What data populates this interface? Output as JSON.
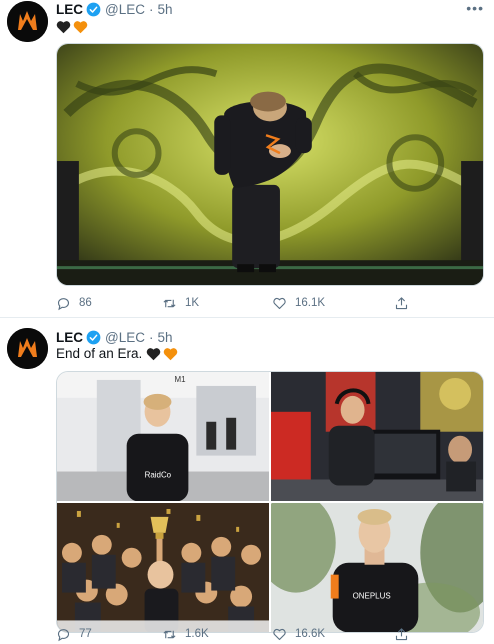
{
  "tweets": [
    {
      "author_name": "LEC",
      "handle": "@LEC",
      "separator": "·",
      "time": "5h",
      "text": "",
      "emoji": [
        "black-heart",
        "orange-heart"
      ],
      "media_count": 1,
      "replies": "86",
      "retweets": "1K",
      "likes": "16.1K"
    },
    {
      "author_name": "LEC",
      "handle": "@LEC",
      "separator": "·",
      "time": "5h",
      "text": "End of an Era.",
      "emoji": [
        "black-heart",
        "orange-heart"
      ],
      "media_count": 4,
      "media_text": [
        "M1",
        "RaidCo",
        "ONEPLUS"
      ],
      "replies": "77",
      "retweets": "1.6K",
      "likes": "16.6K"
    }
  ],
  "colors": {
    "verified": "#1da1f2",
    "secondary_text": "#5b7083",
    "divider": "#e6ecf0",
    "brand_orange": "#f07d1c",
    "black_heart": "#222222",
    "orange_heart": "#f4900c"
  }
}
